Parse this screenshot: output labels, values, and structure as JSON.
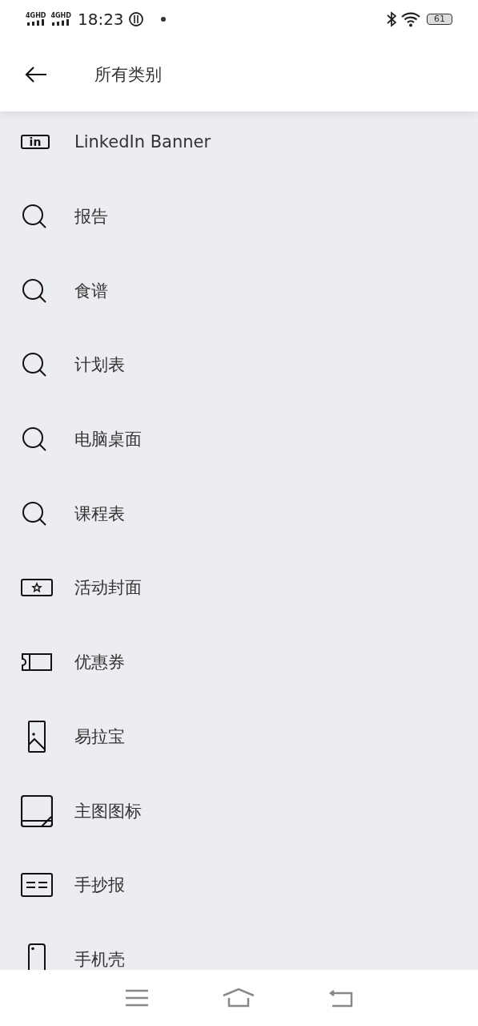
{
  "status_bar": {
    "networks": [
      "4GHD",
      "4GHD"
    ],
    "time": "18:23",
    "battery": "61"
  },
  "header": {
    "title": "所有类别"
  },
  "items": [
    {
      "kind": "linkedin",
      "icon_text": "in",
      "label": "LinkedIn Banner"
    },
    {
      "kind": "search",
      "label": "报告"
    },
    {
      "kind": "search",
      "label": "食谱"
    },
    {
      "kind": "search",
      "label": "计划表"
    },
    {
      "kind": "search",
      "label": "电脑桌面"
    },
    {
      "kind": "search",
      "label": "课程表"
    },
    {
      "kind": "star-card",
      "label": "活动封面"
    },
    {
      "kind": "ticket",
      "label": "优惠券"
    },
    {
      "kind": "portrait",
      "label": "易拉宝"
    },
    {
      "kind": "square",
      "label": "主图图标"
    },
    {
      "kind": "dash-card",
      "label": "手抄报"
    },
    {
      "kind": "phone",
      "label": "手机壳"
    }
  ]
}
